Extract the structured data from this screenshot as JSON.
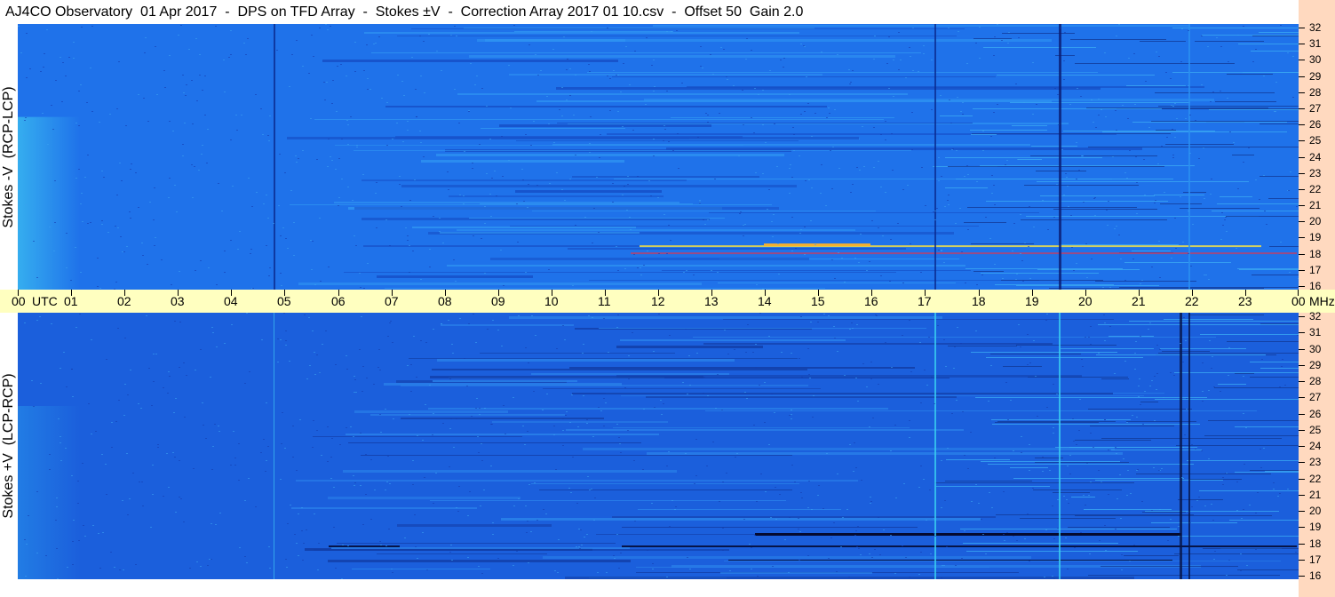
{
  "title": "AJ4CO Observatory  01 Apr 2017  -  DPS on TFD Array  -  Stokes ±V  -  Correction Array 2017 01 10.csv  -  Offset 50  Gain 2.0",
  "panels": [
    {
      "label": "Stokes -V  (RCP-LCP)"
    },
    {
      "label": "Stokes +V  (LCP-RCP)"
    }
  ],
  "time_axis": {
    "utc_label": "UTC",
    "unit_label": "MHz"
  },
  "colors": {
    "background": "#1f6ee6",
    "axis_band": "#ffffc0",
    "freq_scale": "#ffd9bf"
  },
  "chart_data": [
    {
      "type": "heatmap",
      "title": "Stokes -V  (RCP-LCP)",
      "x": [
        "00",
        "01",
        "02",
        "03",
        "04",
        "05",
        "06",
        "07",
        "08",
        "09",
        "10",
        "11",
        "12",
        "13",
        "14",
        "15",
        "16",
        "17",
        "18",
        "19",
        "20",
        "21",
        "22",
        "23",
        "00"
      ],
      "y": [
        16,
        17,
        18,
        19,
        20,
        21,
        22,
        23,
        24,
        25,
        26,
        27,
        28,
        29,
        30,
        31,
        32
      ],
      "xlim": [
        0,
        24
      ],
      "ylim": [
        16,
        32
      ]
    },
    {
      "type": "heatmap",
      "title": "Stokes +V  (LCP-RCP)",
      "x": [
        "00",
        "01",
        "02",
        "03",
        "04",
        "05",
        "06",
        "07",
        "08",
        "09",
        "10",
        "11",
        "12",
        "13",
        "14",
        "15",
        "16",
        "17",
        "18",
        "19",
        "20",
        "21",
        "22",
        "23",
        "00"
      ],
      "y": [
        16,
        17,
        18,
        19,
        20,
        21,
        22,
        23,
        24,
        25,
        26,
        27,
        28,
        29,
        30,
        31,
        32
      ],
      "xlim": [
        0,
        24
      ],
      "ylim": [
        16,
        32
      ]
    }
  ]
}
